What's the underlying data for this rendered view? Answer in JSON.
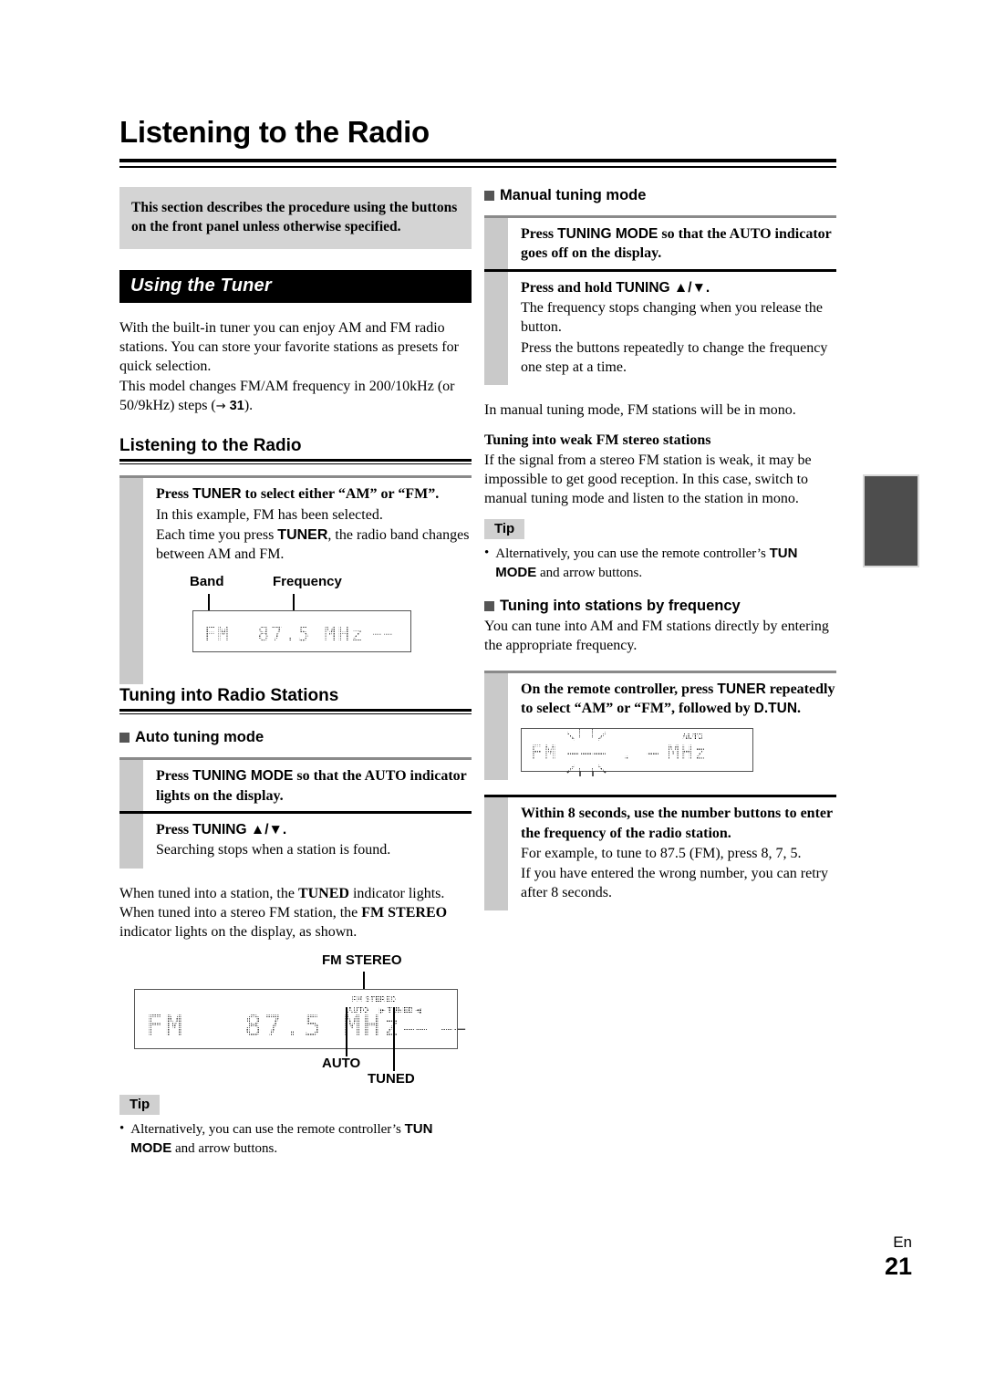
{
  "page": {
    "title": "Listening to the Radio",
    "footer_lang": "En",
    "footer_number": "21"
  },
  "intro_note": "This section describes the procedure using the buttons on the front panel unless otherwise specified.",
  "section_bar": {
    "label": "Using the Tuner"
  },
  "left": {
    "intro_p1": "With the built-in tuner you can enjoy AM and FM radio stations. You can store your favorite stations as presets for quick selection.",
    "intro_p2_a": "This model changes FM/AM frequency in 200/10kHz (or 50/9kHz) steps (",
    "intro_p2_arrow": "→",
    "intro_p2_page": "31",
    "intro_p2_b": ").",
    "h2_listening": "Listening to the Radio",
    "step1_title_a": "Press ",
    "step1_title_b": "TUNER",
    "step1_title_c": " to select either “AM” or “FM”.",
    "step1_line1": "In this example, FM has been selected.",
    "step1_line2_a": "Each time you press ",
    "step1_line2_b": "TUNER",
    "step1_line2_c": ", the radio band changes between AM and FM.",
    "callout_band": "Band",
    "callout_frequency": "Frequency",
    "lcd_small": "FM  87.5 MHz",
    "lcd_small_dashes": "––",
    "h2_tuning": "Tuning into Radio Stations",
    "h3_auto": "Auto tuning mode",
    "auto_step1_a": "Press ",
    "auto_step1_b": "TUNING MODE",
    "auto_step1_c": " so that the AUTO indicator lights on the display.",
    "auto_step2_a": "Press ",
    "auto_step2_b": "TUNING",
    "auto_step2_c": " ▲/▼.",
    "auto_step2_text": "Searching stops when a station is found.",
    "tuned_p_a": "When tuned into a station, the ",
    "tuned_p_b": "TUNED",
    "tuned_p_c": " indicator lights. When tuned into a stereo FM station, the ",
    "tuned_p_d": "FM STEREO",
    "tuned_p_e": " indicator lights on the display, as shown.",
    "big_lcd": {
      "callout_fm_stereo": "FM STEREO",
      "callout_auto": "AUTO",
      "callout_tuned": "TUNED",
      "ind_fm_stereo": "FM STEREO",
      "ind_auto": "AUTO",
      "ind_tuned": "▶ TUNED ◀",
      "text": "FM   87.5 MHz",
      "dashes": "–– ––"
    },
    "tip": {
      "label": "Tip",
      "bullet": "•",
      "text_a": "Alternatively, you can use the remote controller’s ",
      "text_b": "TUN MODE",
      "text_c": " and arrow buttons."
    }
  },
  "right": {
    "h3_manual": "Manual tuning mode",
    "man_step1_a": "Press ",
    "man_step1_b": "TUNING MODE",
    "man_step1_c": " so that the AUTO indicator goes off on the display.",
    "man_step2_a": "Press and hold ",
    "man_step2_b": "TUNING",
    "man_step2_c": " ▲/▼.",
    "man_step2_line1": "The frequency stops changing when you release the button.",
    "man_step2_line2": "Press the buttons repeatedly to change the frequency one step at a time.",
    "mono_p": "In manual tuning mode, FM stations will be in mono.",
    "weak_heading": "Tuning into weak FM stereo stations",
    "weak_p": "If the signal from a stereo FM station is weak, it may be impossible to get good reception. In this case, switch to manual tuning mode and listen to the station in mono.",
    "tip": {
      "label": "Tip",
      "bullet": "•",
      "text_a": "Alternatively, you can use the remote controller’s ",
      "text_b": "TUN MODE",
      "text_c": " and arrow buttons."
    },
    "h3_by_freq": "Tuning into stations by frequency",
    "by_freq_p": "You can tune into AM and FM stations directly by entering the appropriate frequency.",
    "freq_step1_a": "On the remote controller, press ",
    "freq_step1_b": "TUNER",
    "freq_step1_c": " repeatedly to select “AM” or “FM”, followed by ",
    "freq_step1_d": "D.TUN",
    "freq_step1_e": ".",
    "freq_lcd": {
      "band": "FM",
      "blank_digits": "––– . –",
      "unit": "MHz",
      "ind_auto": "AUTO"
    },
    "freq_step2_title": "Within 8 seconds, use the number buttons to enter the frequency of the radio station.",
    "freq_step2_line1": "For example, to tune to 87.5 (FM), press 8, 7, 5.",
    "freq_step2_line2": "If you have entered the wrong number, you can retry after 8 seconds."
  }
}
